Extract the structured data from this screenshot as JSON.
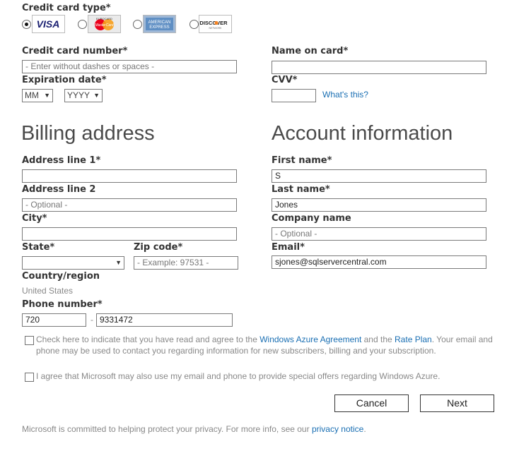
{
  "card_type": {
    "label": "Credit card type*",
    "options": [
      {
        "name": "VISA",
        "selected": true
      },
      {
        "name": "MasterCard",
        "selected": false
      },
      {
        "name": "American Express",
        "selected": false
      },
      {
        "name": "DISCOVER",
        "selected": false
      }
    ]
  },
  "card_number": {
    "label": "Credit card number*",
    "placeholder": "- Enter without dashes or spaces -"
  },
  "name_on_card": {
    "label": "Name on card*",
    "value": ""
  },
  "expiration": {
    "label": "Expiration date*",
    "month": "MM",
    "year": "YYYY"
  },
  "cvv": {
    "label": "CVV*",
    "value": "",
    "help_link": "What's this?"
  },
  "billing": {
    "heading": "Billing address",
    "address1": {
      "label": "Address line 1*",
      "value": ""
    },
    "address2": {
      "label": "Address line 2",
      "placeholder": "- Optional -"
    },
    "city": {
      "label": "City*",
      "value": ""
    },
    "state": {
      "label": "State*",
      "value": ""
    },
    "zip": {
      "label": "Zip code*",
      "placeholder": "- Example: 97531 -"
    },
    "country": {
      "label": "Country/region",
      "value": "United States"
    },
    "phone": {
      "label": "Phone number*",
      "area_code": "720",
      "separator": "-",
      "number": "9331472"
    }
  },
  "account": {
    "heading": "Account information",
    "first_name": {
      "label": "First name*",
      "value": "S"
    },
    "last_name": {
      "label": "Last name*",
      "value": "Jones"
    },
    "company": {
      "label": "Company name",
      "placeholder": "- Optional -"
    },
    "email": {
      "label": "Email*",
      "value": "sjones@sqlservercentral.com"
    }
  },
  "agreement": {
    "text_before": "Check here to indicate that you have read and agree to the ",
    "agreement_link": "Windows Azure Agreement",
    "text_middle": " and the ",
    "rate_link": "Rate Plan",
    "text_after": ". Your email and phone may be used to contact you regarding information for new subscribers, billing and your subscription.",
    "checked": false
  },
  "offers": {
    "text": "I agree that Microsoft may also use my email and phone to provide special offers regarding Windows Azure.",
    "checked": false
  },
  "buttons": {
    "cancel": "Cancel",
    "next": "Next"
  },
  "privacy": {
    "text": "Microsoft is committed to helping protect your privacy. For more info, see our ",
    "link": "privacy notice",
    "end": "."
  }
}
